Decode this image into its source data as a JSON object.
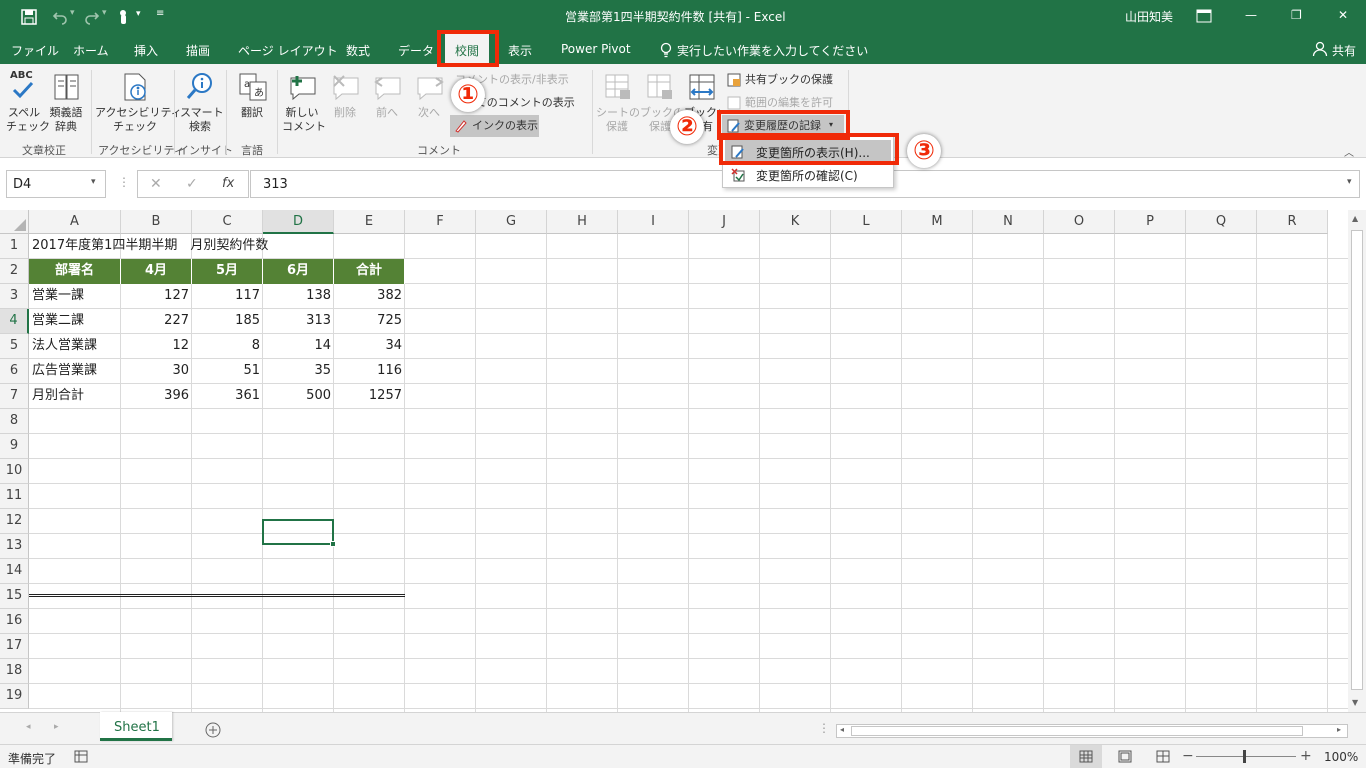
{
  "window": {
    "title": "営業部第1四半期契約件数 [共有] - Excel",
    "user": "山田知美",
    "restore_icon": "ribbon-display-icon",
    "minimize": "—",
    "maximize": "❐",
    "close": "✕"
  },
  "qat": {
    "save": "save-icon",
    "undo": "undo-icon",
    "redo": "redo-icon",
    "touch": "touch-mode-icon",
    "customize": "▾"
  },
  "tabs": [
    {
      "label": "ファイル"
    },
    {
      "label": "ホーム"
    },
    {
      "label": "挿入"
    },
    {
      "label": "描画"
    },
    {
      "label": "ページ レイアウト"
    },
    {
      "label": "数式"
    },
    {
      "label": "データ"
    },
    {
      "label": "校閲"
    },
    {
      "label": "表示"
    },
    {
      "label": "Power Pivot"
    }
  ],
  "tell_me": "実行したい作業を入力してください",
  "share": "共有",
  "ribbon": {
    "proofing": {
      "spell": "スペル\nチェック",
      "spell_top": "ABC",
      "thesaurus": "類義語\n辞典",
      "group": "文章校正"
    },
    "accessibility": {
      "check": "アクセシビリティ\nチェック",
      "group": "アクセシビリティ"
    },
    "insights": {
      "smart": "スマート\n検索",
      "group": "インサイト"
    },
    "language": {
      "translate": "翻訳",
      "group": "言語"
    },
    "comments": {
      "new": "新しい\nコメント",
      "delete": "削除",
      "prev": "前へ",
      "next": "次へ",
      "show_hide": "コメントの表示/非表示",
      "show_all": "すべてのコメントの表示",
      "ink": "インクの表示",
      "group": "コメント"
    },
    "changes": {
      "protect_sheet": "シートの\n保護",
      "protect_book": "ブックの\n保護",
      "share_book": "ブックの\n共有",
      "protect_shared": "共有ブックの保護",
      "allow_edit": "範囲の編集を許可",
      "track": "変更履歴の記録",
      "group": "変更"
    }
  },
  "dropdown": {
    "items": [
      {
        "label": "変更箇所の表示(H)..."
      },
      {
        "label": "変更箇所の確認(C)"
      }
    ]
  },
  "callouts": [
    "①",
    "②",
    "③"
  ],
  "formula_bar": {
    "name_box": "D4",
    "fx": "fx",
    "value": "313"
  },
  "columns": [
    "A",
    "B",
    "C",
    "D",
    "E",
    "F",
    "G",
    "H",
    "I",
    "J",
    "K",
    "L",
    "M",
    "N",
    "O",
    "P",
    "Q",
    "R"
  ],
  "rows": [
    "1",
    "2",
    "3",
    "4",
    "5",
    "6",
    "7",
    "8",
    "9",
    "10",
    "11",
    "12",
    "13",
    "14",
    "15",
    "16",
    "17",
    "18",
    "19"
  ],
  "sheet": {
    "title": "2017年度第1四半期半期　月別契約件数",
    "header": [
      "部署名",
      "4月",
      "5月",
      "6月",
      "合計"
    ],
    "data": [
      [
        "営業一課",
        "127",
        "117",
        "138",
        "382"
      ],
      [
        "営業二課",
        "227",
        "185",
        "313",
        "725"
      ],
      [
        "法人営業課",
        "12",
        "8",
        "14",
        "34"
      ],
      [
        "広告営業課",
        "30",
        "51",
        "35",
        "116"
      ],
      [
        "月別合計",
        "396",
        "361",
        "500",
        "1257"
      ]
    ]
  },
  "sheet_tabs": [
    {
      "label": "Sheet1"
    }
  ],
  "status": {
    "ready": "準備完了",
    "zoom": "100%"
  }
}
